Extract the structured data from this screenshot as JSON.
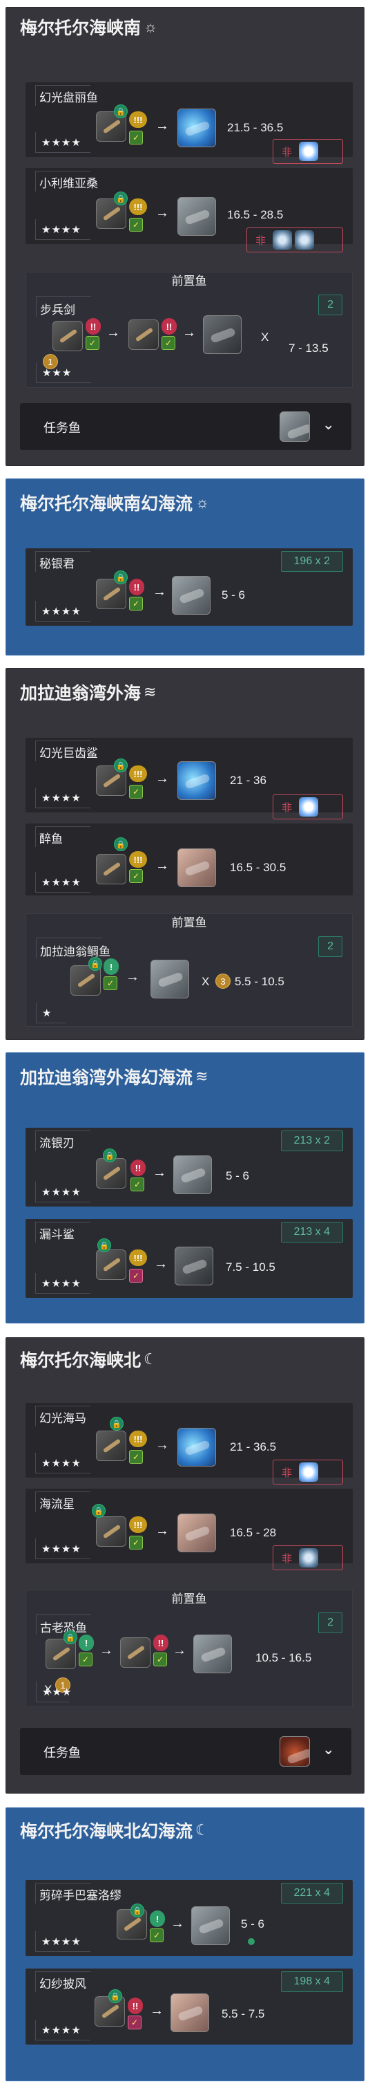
{
  "sections": [
    {
      "title": "梅尔托尔海峡南",
      "weather_icon": "sun-icon",
      "fish": [
        {
          "name": "幻光盘丽鱼",
          "stars": "★★★★",
          "tug": "!!!",
          "range": "21.5 - 36.5",
          "cond_label": "非"
        },
        {
          "name": "小利维亚桑",
          "stars": "★★★★",
          "tug": "!!!",
          "range": "16.5 - 28.5",
          "cond_label": "非"
        }
      ],
      "pre_title": "前置鱼",
      "pre_fish": {
        "name": "步兵剑",
        "stars": "★★★",
        "tug1": "!!",
        "tug2": "!!",
        "x": "X",
        "range": "7 - 13.5",
        "spot": "2",
        "coin": "1"
      },
      "task": {
        "label": "任务鱼",
        "chevron": "⌄"
      }
    },
    {
      "title": "梅尔托尔海峡南幻海流",
      "weather_icon": "sun-icon",
      "fish": [
        {
          "name": "秘银君",
          "stars": "★★★★",
          "tug": "!!",
          "range": "5 - 6",
          "spot": "196 x 2"
        }
      ]
    },
    {
      "title": "加拉迪翁湾外海",
      "weather_icon": "fog-icon",
      "fish": [
        {
          "name": "幻光巨齿鲨",
          "stars": "★★★★",
          "tug": "!!!",
          "range": "21 - 36",
          "cond_label": "非"
        },
        {
          "name": "醉鱼",
          "stars": "★★★★",
          "tug": "!!!",
          "range": "16.5 - 30.5"
        }
      ],
      "pre_title": "前置鱼",
      "pre_fish": {
        "name": "加拉迪翁鲷鱼",
        "stars": "★",
        "tug": "!",
        "x": "X",
        "coin": "3",
        "range": "5.5 - 10.5",
        "spot": "2"
      }
    },
    {
      "title": "加拉迪翁湾外海幻海流",
      "weather_icon": "fog-icon",
      "fish": [
        {
          "name": "流银刃",
          "stars": "★★★★",
          "tug": "!!",
          "range": "5 - 6",
          "spot": "213 x 2"
        },
        {
          "name": "漏斗鲨",
          "stars": "★★★★",
          "tug": "!!!",
          "range": "7.5 - 10.5",
          "spot": "213 x 4"
        }
      ]
    },
    {
      "title": "梅尔托尔海峡北",
      "weather_icon": "moon-icon",
      "fish": [
        {
          "name": "幻光海马",
          "stars": "★★★★",
          "tug": "!!!",
          "range": "21 - 36.5",
          "cond_label": "非"
        },
        {
          "name": "海流星",
          "stars": "★★★★",
          "tug": "!!!",
          "range": "16.5 - 28",
          "cond_label": "非"
        }
      ],
      "pre_title": "前置鱼",
      "pre_fish": {
        "name": "古老恐鱼",
        "stars": "★★★",
        "tug1": "!",
        "tug2": "!!",
        "x": "X",
        "coin": "1",
        "range": "10.5 - 16.5",
        "spot": "2"
      },
      "task": {
        "label": "任务鱼",
        "chevron": "⌄"
      }
    },
    {
      "title": "梅尔托尔海峡北幻海流",
      "weather_icon": "moon-icon",
      "fish": [
        {
          "name": "剪碎手巴塞洛缪",
          "stars": "★★★★",
          "tug": "!",
          "range": "5 - 6",
          "spot": "221 x 4"
        },
        {
          "name": "幻纱披风",
          "stars": "★★★★",
          "tug": "!!",
          "range": "5.5 - 7.5",
          "spot": "198 x 4"
        }
      ]
    }
  ],
  "icons": {
    "lock": "lock-icon",
    "arrow": "→",
    "hook": "hook-icon",
    "weather_sun": "☼",
    "weather_fog": "≋",
    "weather_moon": "☾"
  },
  "colors": {
    "dark_section": "#35353b",
    "blue_section": "#2d5f9a",
    "card": "#26262b",
    "spot_text": "#5fb89f",
    "cond_border": "#c04a5a"
  }
}
